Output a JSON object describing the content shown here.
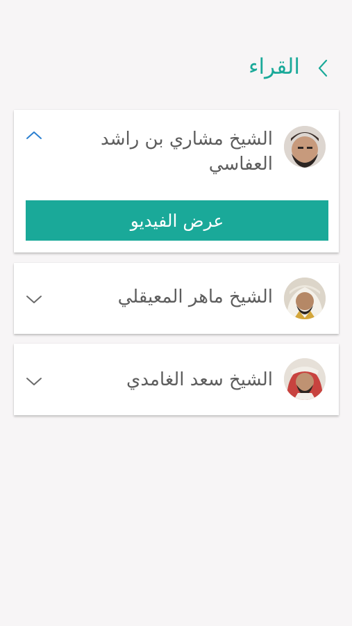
{
  "header": {
    "title": "القراء",
    "back_icon": "chevron-left-icon"
  },
  "colors": {
    "accent": "#1aa999",
    "background": "#f7f5f6",
    "card": "#ffffff",
    "text": "#5d5d5d",
    "chevron": "#6b6b6b",
    "chevron_active": "#2a7fd0"
  },
  "reciters": [
    {
      "name": "الشيخ مشاري بن راشد العفاسي",
      "expanded": true,
      "toggle_icon": "chevron-up-icon",
      "video_button_label": "عرض الفيديو"
    },
    {
      "name": "الشيخ ماهر المعيقلي",
      "expanded": false,
      "toggle_icon": "chevron-down-icon"
    },
    {
      "name": "الشيخ سعد الغامدي",
      "expanded": false,
      "toggle_icon": "chevron-down-icon"
    }
  ]
}
